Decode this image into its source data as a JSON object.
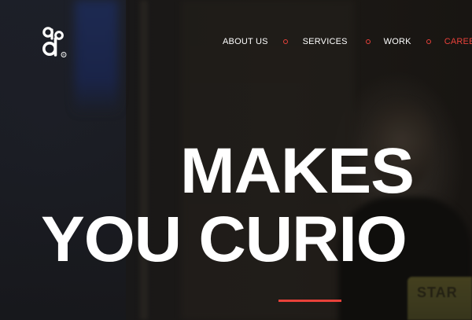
{
  "logo": {
    "icon": "brand-logo-icon",
    "registered_mark": "®"
  },
  "nav": {
    "items": [
      {
        "label": "ABOUT US",
        "active": false
      },
      {
        "label": "SERVICES",
        "active": false
      },
      {
        "label": "WORK",
        "active": false
      },
      {
        "label": "CAREERS",
        "active": true
      }
    ],
    "separator_icon": "circle-dot-icon"
  },
  "hero": {
    "headline_line_1": "MAKES",
    "headline_line_2": "YOU CURIO",
    "background_text": "STAR"
  },
  "colors": {
    "accent": "#e8413a",
    "text": "#ffffff",
    "background": "#161412"
  }
}
